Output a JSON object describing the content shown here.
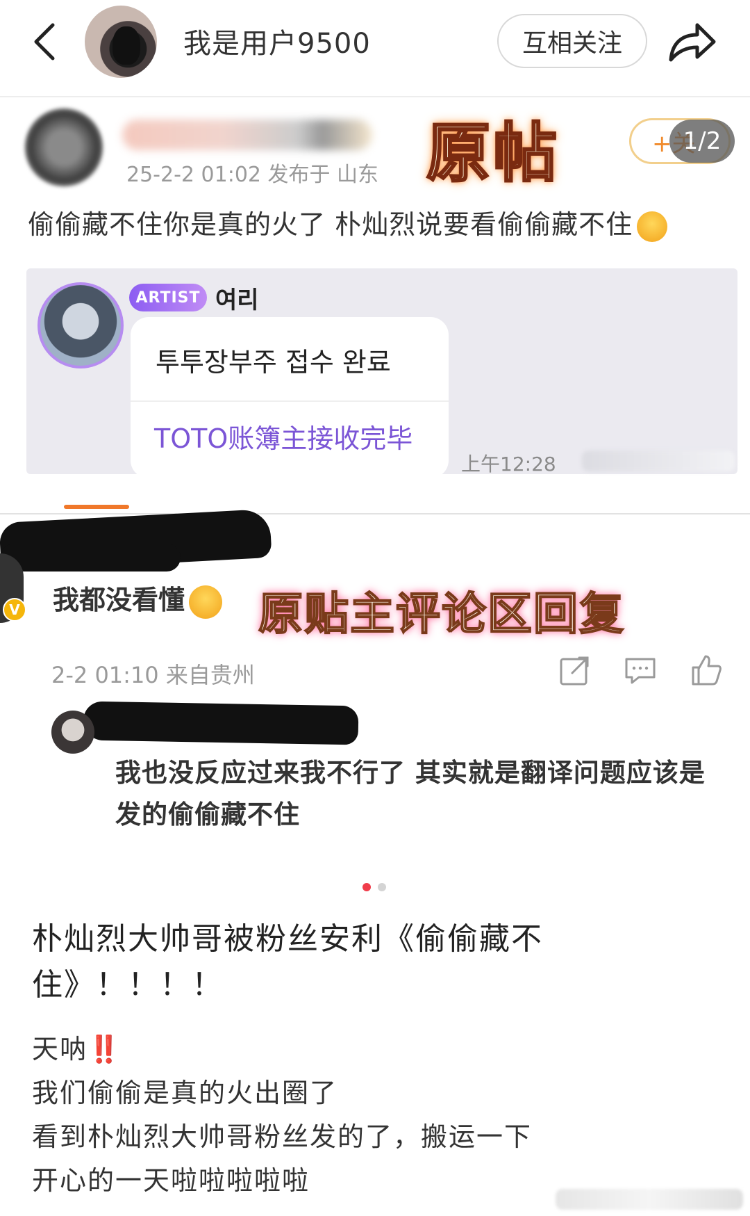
{
  "nav": {
    "username": "我是用户9500",
    "follow_label": "互相关注"
  },
  "screenshot": {
    "overlay_label_original_post": "原帖",
    "page_indicator": "1/2",
    "op_follow_label": "+关",
    "op_meta": "25-2-2 01:02  发布于 山东",
    "op_text": "偷偷藏不住你是真的火了 朴灿烈说要看偷偷藏不住",
    "artist_card": {
      "badge": "ARTIST",
      "name": "여리",
      "message_korean": "투투장부주 접수 완료",
      "message_chinese": "TOTO账簿主接收完毕",
      "time": "上午12:28"
    },
    "comment1": {
      "text": "我都没看懂",
      "overlay_label": "原贴主评论区回复",
      "meta": "2-2 01:10 来自贵州"
    },
    "comment2": {
      "text": "我也没反应过来我不行了 其实就是翻译问题应该是发的偷偷藏不住"
    }
  },
  "carousel": {
    "total": 2,
    "active_index": 0
  },
  "post": {
    "title": "朴灿烈大帅哥被粉丝安利《偷偷藏不住》！！！！",
    "line1": "天呐",
    "line1_emoji": "‼️",
    "line2": "我们偷偷是真的火出圈了",
    "line3": "看到朴灿烈大帅哥粉丝发的了，搬运一下",
    "line4": "开心的一天啦啦啦啦啦"
  },
  "colors": {
    "accent_orange": "#f0782a",
    "artist_purple": "#8c5df2",
    "translation_purple": "#7b55d6",
    "dot_active": "#f03c4a"
  }
}
